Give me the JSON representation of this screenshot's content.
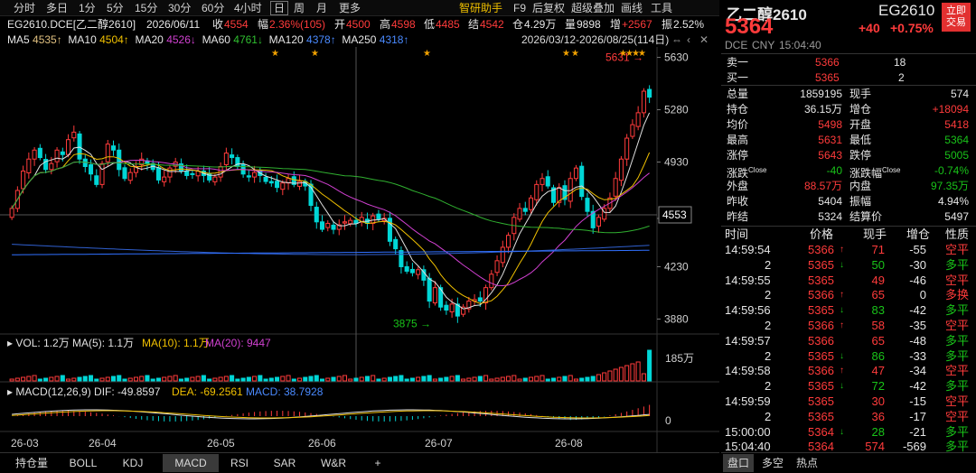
{
  "toolbar": {
    "periods": [
      "分时",
      "多日",
      "1分",
      "5分",
      "15分",
      "30分",
      "60分",
      "4小时",
      "日",
      "周",
      "月",
      "更多"
    ],
    "selected_period": "日",
    "tools": [
      "智研助手",
      "F9",
      "后复权",
      "超级叠加",
      "画线",
      "工具"
    ]
  },
  "info": {
    "symbol": "EG2610.DCE[乙二醇2610]",
    "date": "2026/06/11",
    "close_label": "收",
    "close": "4554",
    "chg_label": "幅",
    "chg": "2.36%(105)",
    "open_label": "开",
    "open": "4500",
    "high_label": "高",
    "high": "4598",
    "low_label": "低",
    "low": "4485",
    "settle_label": "结",
    "settle": "4542",
    "oi_label": "仓",
    "oi": "4.29万",
    "vol_label": "量",
    "vol": "9898",
    "inc_label": "增",
    "inc": "+2567",
    "amp_label": "振",
    "amp": "2.52%"
  },
  "ma": {
    "ma5": "MA5",
    "ma5_val": "4535↑",
    "ma10": "MA10",
    "ma10_val": "4504↑",
    "ma20": "MA20",
    "ma20_val": "4526↓",
    "ma60": "MA60",
    "ma60_val": "4761↓",
    "ma120": "MA120",
    "ma120_val": "4378↑",
    "ma250": "MA250",
    "ma250_val": "4318↑",
    "range": "2026/03/12-2026/08/25(114日)"
  },
  "price_axis": [
    "5630",
    "5280",
    "4930",
    "4553",
    "4230",
    "3880"
  ],
  "annotations": {
    "high": "5631",
    "low": "3875"
  },
  "vol_panel": {
    "label": "VOL: 1.2万",
    "ma5": "MA(5): 1.1万",
    "ma10": "MA(10): 1.1万",
    "ma20": "MA(20): 9447",
    "axis": "185万"
  },
  "macd_panel": {
    "label": "MACD(12,26,9)",
    "dif": "DIF: -49.8597",
    "dea": "DEA: -69.2561",
    "macd": "MACD: 38.7928",
    "axis": "0"
  },
  "date_axis": [
    "26-03",
    "26-04",
    "26-05",
    "26-06",
    "26-07",
    "26-08"
  ],
  "bottom_tabs": [
    "持仓量",
    "BOLL",
    "KDJ",
    "MACD",
    "RSI",
    "SAR",
    "W&R",
    "+"
  ],
  "selected_tab": "MACD",
  "quote": {
    "name": "乙二醇2610",
    "code": "EG2610",
    "trade_btn": "立即\n交易",
    "last": "5364",
    "change": "+40",
    "change_pct": "+0.75%",
    "exchange": "DCE",
    "currency": "CNY",
    "time": "15:04:40",
    "ask_label": "卖一",
    "ask": "5366",
    "ask_vol": "18",
    "bid_label": "买一",
    "bid": "5365",
    "bid_vol": "2",
    "stats": [
      {
        "l1": "总量",
        "v1": "1859195",
        "l2": "现手",
        "v2": "574"
      },
      {
        "l1": "持仓",
        "v1": "36.15万",
        "l2": "增仓",
        "v2": "+18094"
      },
      {
        "l1": "均价",
        "v1": "5498",
        "l2": "开盘",
        "v2": "5418"
      },
      {
        "l1": "最高",
        "v1": "5631",
        "l2": "最低",
        "v2": "5364"
      },
      {
        "l1": "涨停",
        "v1": "5643",
        "l2": "跌停",
        "v2": "5005"
      },
      {
        "l1": "涨跌",
        "s1": "Close",
        "v1": "-40",
        "l2": "涨跌幅",
        "s2": "Close",
        "v2": "-0.74%"
      },
      {
        "l1": "外盘",
        "v1": "88.57万",
        "l2": "内盘",
        "v2": "97.35万"
      },
      {
        "l1": "昨收",
        "v1": "5404",
        "l2": "振幅",
        "v2": "4.94%"
      },
      {
        "l1": "昨结",
        "v1": "5324",
        "l2": "结算价",
        "v2": "5497"
      }
    ],
    "tick_headers": [
      "时间",
      "价格",
      "现手",
      "增仓",
      "性质"
    ],
    "ticks": [
      {
        "t": "14:59:54",
        "p": "5366",
        "d": "up",
        "v": "71",
        "c": "-55",
        "n": "空平"
      },
      {
        "t": "2",
        "p": "5365",
        "d": "down",
        "v": "50",
        "c": "-30",
        "n": "多平"
      },
      {
        "t": "14:59:55",
        "p": "5365",
        "d": "",
        "v": "49",
        "c": "-46",
        "n": "空平"
      },
      {
        "t": "2",
        "p": "5366",
        "d": "up",
        "v": "65",
        "c": "0",
        "n": "多换"
      },
      {
        "t": "14:59:56",
        "p": "5365",
        "d": "down",
        "v": "83",
        "c": "-42",
        "n": "多平"
      },
      {
        "t": "2",
        "p": "5366",
        "d": "up",
        "v": "58",
        "c": "-35",
        "n": "空平"
      },
      {
        "t": "14:59:57",
        "p": "5366",
        "d": "",
        "v": "65",
        "c": "-48",
        "n": "多平"
      },
      {
        "t": "2",
        "p": "5365",
        "d": "down",
        "v": "86",
        "c": "-33",
        "n": "多平"
      },
      {
        "t": "14:59:58",
        "p": "5366",
        "d": "up",
        "v": "47",
        "c": "-34",
        "n": "空平"
      },
      {
        "t": "2",
        "p": "5365",
        "d": "down",
        "v": "72",
        "c": "-42",
        "n": "多平"
      },
      {
        "t": "14:59:59",
        "p": "5365",
        "d": "",
        "v": "30",
        "c": "-15",
        "n": "空平"
      },
      {
        "t": "2",
        "p": "5365",
        "d": "",
        "v": "36",
        "c": "-17",
        "n": "空平"
      },
      {
        "t": "15:00:00",
        "p": "5364",
        "d": "down",
        "v": "28",
        "c": "-21",
        "n": "多平"
      },
      {
        "t": "15:04:40",
        "p": "5364",
        "d": "",
        "v": "574",
        "c": "-569",
        "n": "多平"
      }
    ],
    "bottom_tabs": [
      "盘口",
      "多空",
      "热点"
    ],
    "selected_bottom_tab": "盘口"
  },
  "colors": {
    "up": "#ff3b3b",
    "down": "#00d6d6",
    "ma5": "#e0e0e0",
    "ma10": "#f0c000",
    "ma20": "#d040d0",
    "ma60": "#30b030",
    "ma120": "#3060d0",
    "ma250": "#3070ff"
  },
  "chart_data": {
    "type": "candlestick",
    "x": [
      "2026-03-12",
      "2026-08-25"
    ],
    "ylim": [
      3780,
      5700
    ],
    "closes": [
      4620,
      4740,
      4870,
      4950,
      5010,
      4960,
      4880,
      4920,
      5010,
      4980,
      5080,
      5130,
      4950,
      4900,
      4850,
      4780,
      4920,
      5050,
      5010,
      4880,
      4820,
      4860,
      4900,
      4950,
      4920,
      4880,
      4810,
      4830,
      4890,
      4930,
      4870,
      4840,
      4850,
      4870,
      4840,
      4810,
      4830,
      4900,
      4990,
      4960,
      4900,
      4850,
      4830,
      4860,
      4840,
      4800,
      4790,
      4760,
      4790,
      4820,
      4780,
      4800,
      4770,
      4640,
      4530,
      4480,
      4520,
      4480,
      4510,
      4530,
      4540,
      4520,
      4560,
      4520,
      4570,
      4550,
      4554,
      4400,
      4350,
      4230,
      4200,
      4190,
      4210,
      4140,
      4000,
      4090,
      3960,
      3940,
      3980,
      3900,
      3960,
      4000,
      4010,
      4000,
      4090,
      4180,
      4270,
      4360,
      4440,
      4560,
      4620,
      4600,
      4690,
      4780,
      4820,
      4770,
      4660,
      4760,
      4680,
      4820,
      4890,
      4700,
      4600,
      4490,
      4560,
      4620,
      4690,
      4820,
      4950,
      5090,
      5180,
      5260,
      5404,
      5364
    ]
  }
}
